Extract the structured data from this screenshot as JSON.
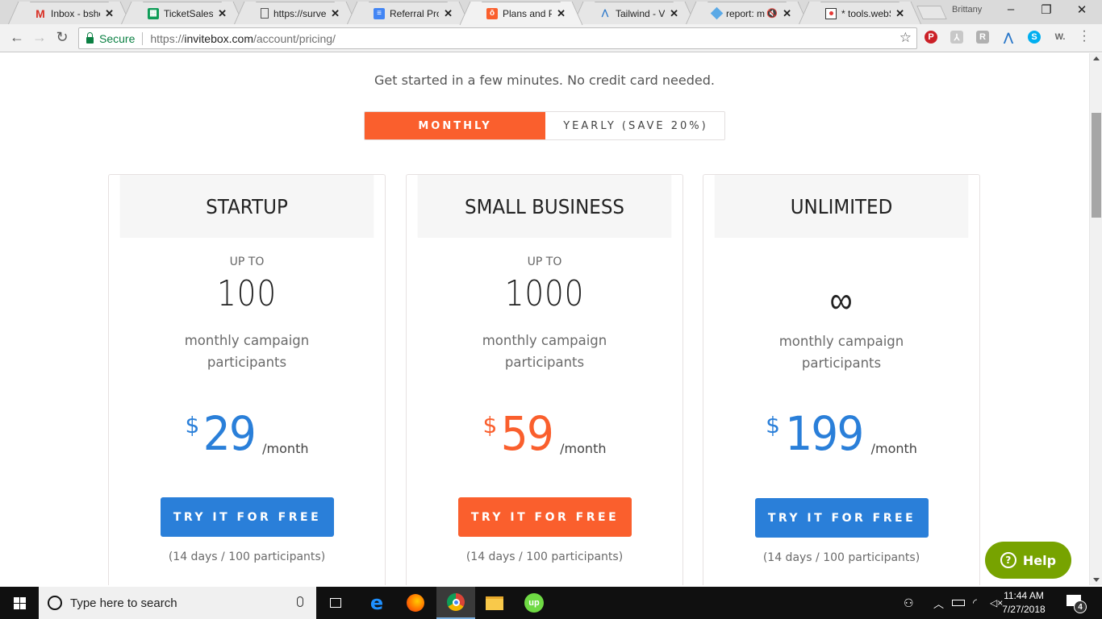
{
  "browser": {
    "tabs": [
      {
        "title": "Inbox - bsheaha",
        "favicon": "gmail-icon",
        "active": false
      },
      {
        "title": "TicketSales Soc",
        "favicon": "google-sheets-icon",
        "active": false
      },
      {
        "title": "https://surveyh",
        "favicon": "page-icon",
        "active": false
      },
      {
        "title": "Referral Progra",
        "favicon": "google-docs-icon",
        "active": false
      },
      {
        "title": "Plans and Pricin",
        "favicon": "invitebox-icon",
        "active": true
      },
      {
        "title": "Tailwind - Visua",
        "favicon": "tailwind-icon",
        "active": false
      },
      {
        "title": "report: mcm",
        "favicon": "report-icon",
        "active": false,
        "muted": true
      },
      {
        "title": "* tools.webSMA",
        "favicon": "websma-icon",
        "active": false
      }
    ],
    "tab_close_glyph": "✕",
    "profile_name": "Brittany",
    "window_controls": {
      "minimize": "–",
      "restore": "❐",
      "close": "✕"
    },
    "nav": {
      "back": "←",
      "forward": "→",
      "reload": "↻"
    },
    "address": {
      "secure_label": "Secure",
      "scheme": "https://",
      "host": "invitebox.com",
      "path": "/account/pricing/"
    },
    "bookmark_star": "☆",
    "extensions": [
      {
        "name": "pinterest-extension-icon",
        "glyph": "P",
        "color": "#cb2027"
      },
      {
        "name": "acrobat-extension-icon",
        "glyph": "⅄",
        "color": "#c8c8c8"
      },
      {
        "name": "rakuten-extension-icon",
        "glyph": "R",
        "color": "#b0b0b0"
      },
      {
        "name": "tailwind-extension-icon",
        "glyph": "⋀",
        "color": "#2a77c9"
      },
      {
        "name": "skype-extension-icon",
        "glyph": "S",
        "color": "#00aff0"
      },
      {
        "name": "w-extension-icon",
        "glyph": "W.",
        "color": "#ffffff"
      }
    ]
  },
  "page": {
    "subtitle": "Get started in a few minutes. No credit card needed.",
    "billing_toggle": {
      "monthly": "MONTHLY",
      "yearly": "YEARLY (SAVE 20%)",
      "selected": "monthly"
    },
    "plans": [
      {
        "name": "STARTUP",
        "up_to": "UP TO",
        "participants": "100",
        "desc_line1": "monthly campaign",
        "desc_line2": "participants",
        "currency": "$",
        "price": "29",
        "period": "/month",
        "cta": "TRY IT FOR FREE",
        "trial": "(14 days / 100 participants)",
        "accent": "#2a7fd9"
      },
      {
        "name": "SMALL BUSINESS",
        "up_to": "UP TO",
        "participants": "1000",
        "desc_line1": "monthly campaign",
        "desc_line2": "participants",
        "currency": "$",
        "price": "59",
        "period": "/month",
        "cta": "TRY IT FOR FREE",
        "trial": "(14 days / 100 participants)",
        "accent": "#fa5f2d"
      },
      {
        "name": "UNLIMITED",
        "up_to": "",
        "participants": "∞",
        "desc_line1": "monthly campaign",
        "desc_line2": "participants",
        "currency": "$",
        "price": "199",
        "period": "/month",
        "cta": "TRY IT FOR FREE",
        "trial": "(14 days / 100 participants)",
        "accent": "#2a7fd9"
      }
    ],
    "help_button": {
      "icon": "?",
      "label": "Help",
      "color": "#77a300"
    }
  },
  "taskbar": {
    "search_placeholder": "Type here to search",
    "pinned": [
      "task-view",
      "edge",
      "firefox",
      "chrome",
      "file-explorer",
      "upwork"
    ],
    "active_app": "chrome",
    "clock_time": "11:44 AM",
    "clock_date": "7/27/2018",
    "notification_count": "4"
  }
}
